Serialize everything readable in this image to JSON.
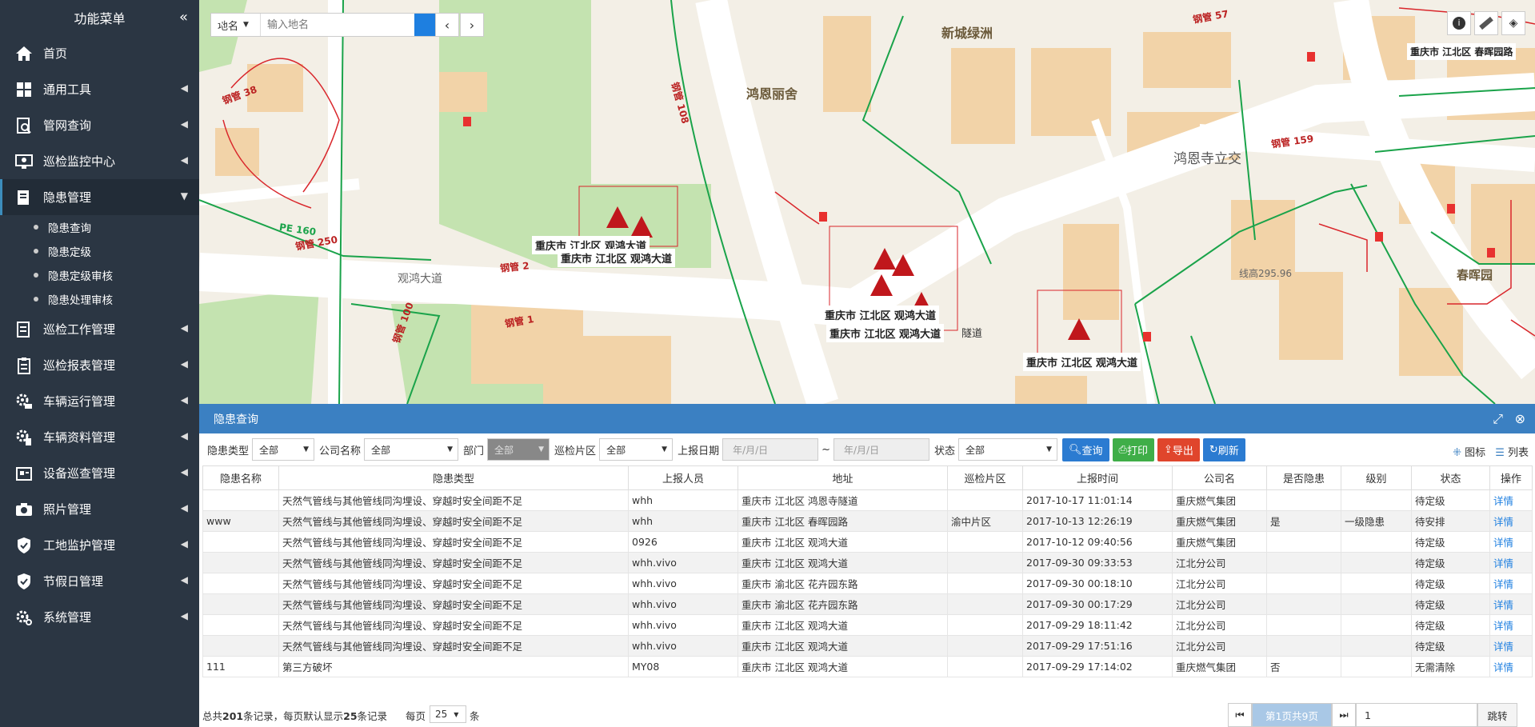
{
  "sidebar": {
    "title": "功能菜单",
    "collapse_icon": "«",
    "items": [
      {
        "label": "首页",
        "icon": "home-icon"
      },
      {
        "label": "通用工具",
        "icon": "grid-icon"
      },
      {
        "label": "管网查询",
        "icon": "search-doc-icon"
      },
      {
        "label": "巡检监控中心",
        "icon": "monitor-icon"
      },
      {
        "label": "隐患管理",
        "icon": "edit-doc-icon"
      },
      {
        "label": "巡检工作管理",
        "icon": "list-doc-icon"
      },
      {
        "label": "巡检报表管理",
        "icon": "clipboard-icon"
      },
      {
        "label": "车辆运行管理",
        "icon": "gear-car-icon"
      },
      {
        "label": "车辆资料管理",
        "icon": "gear-doc-icon"
      },
      {
        "label": "设备巡查管理",
        "icon": "device-icon"
      },
      {
        "label": "照片管理",
        "icon": "camera-icon"
      },
      {
        "label": "工地监护管理",
        "icon": "shield-icon"
      },
      {
        "label": "节假日管理",
        "icon": "shield-icon"
      },
      {
        "label": "系统管理",
        "icon": "gear-icon"
      }
    ],
    "sub_items": [
      "隐患查询",
      "隐患定级",
      "隐患定级审核",
      "隐患处理审核"
    ]
  },
  "map": {
    "search_type": "地名",
    "search_placeholder": "输入地名",
    "place_labels": [
      "新城绿洲",
      "鸿恩丽舍",
      "鸿恩寺立交",
      "春晖园",
      "观鸿大道",
      "线高295.96",
      "隧道"
    ],
    "pipe_labels": [
      "钢管 57",
      "钢管 159",
      "钢管 108",
      "钢管 38",
      "钢管 250",
      "PE 160",
      "钢管 2",
      "钢管 1",
      "钢管 100"
    ],
    "hazard_labels": [
      "重庆市 江北区 观鸿大道",
      "重庆市 江北区 观鸿大道",
      "重庆市 江北区 观鸿大道",
      "重庆市 江北区 观鸿大道",
      "重庆市 江北区 观鸿大道"
    ],
    "top_right_label": "重庆市 江北区 春晖园路"
  },
  "panel": {
    "title": "隐患查询",
    "filters": {
      "type_label": "隐患类型",
      "type_value": "全部",
      "company_label": "公司名称",
      "company_value": "全部",
      "dept_label": "部门",
      "dept_value": "全部",
      "area_label": "巡检片区",
      "area_value": "全部",
      "date_label": "上报日期",
      "date_from": "年/月/日",
      "date_sep": "~",
      "date_to": "年/月/日",
      "status_label": "状态",
      "status_value": "全部"
    },
    "buttons": {
      "query": "查询",
      "print": "打印",
      "export": "导出",
      "refresh": "刷新"
    },
    "view": {
      "icon_view": "图标",
      "list_view": "列表"
    },
    "columns": [
      "隐患名称",
      "隐患类型",
      "上报人员",
      "地址",
      "巡检片区",
      "上报时间",
      "公司名",
      "是否隐患",
      "级别",
      "状态",
      "操作"
    ],
    "rows": [
      [
        "",
        "天然气管线与其他管线同沟埋设、穿越时安全间距不足",
        "whh",
        "重庆市 江北区 鸿恩寺隧道",
        "",
        "2017-10-17 11:01:14",
        "重庆燃气集团",
        "",
        "",
        "待定级",
        "详情"
      ],
      [
        "www",
        "天然气管线与其他管线同沟埋设、穿越时安全间距不足",
        "whh",
        "重庆市 江北区 春晖园路",
        "渝中片区",
        "2017-10-13 12:26:19",
        "重庆燃气集团",
        "是",
        "一级隐患",
        "待安排",
        "详情"
      ],
      [
        "",
        "天然气管线与其他管线同沟埋设、穿越时安全间距不足",
        "0926",
        "重庆市 江北区 观鸿大道",
        "",
        "2017-10-12 09:40:56",
        "重庆燃气集团",
        "",
        "",
        "待定级",
        "详情"
      ],
      [
        "",
        "天然气管线与其他管线同沟埋设、穿越时安全间距不足",
        "whh.vivo",
        "重庆市 江北区 观鸿大道",
        "",
        "2017-09-30 09:33:53",
        "江北分公司",
        "",
        "",
        "待定级",
        "详情"
      ],
      [
        "",
        "天然气管线与其他管线同沟埋设、穿越时安全间距不足",
        "whh.vivo",
        "重庆市 渝北区 花卉园东路",
        "",
        "2017-09-30 00:18:10",
        "江北分公司",
        "",
        "",
        "待定级",
        "详情"
      ],
      [
        "",
        "天然气管线与其他管线同沟埋设、穿越时安全间距不足",
        "whh.vivo",
        "重庆市 渝北区 花卉园东路",
        "",
        "2017-09-30 00:17:29",
        "江北分公司",
        "",
        "",
        "待定级",
        "详情"
      ],
      [
        "",
        "天然气管线与其他管线同沟埋设、穿越时安全间距不足",
        "whh.vivo",
        "重庆市 江北区 观鸿大道",
        "",
        "2017-09-29 18:11:42",
        "江北分公司",
        "",
        "",
        "待定级",
        "详情"
      ],
      [
        "",
        "天然气管线与其他管线同沟埋设、穿越时安全间距不足",
        "whh.vivo",
        "重庆市 江北区 观鸿大道",
        "",
        "2017-09-29 17:51:16",
        "江北分公司",
        "",
        "",
        "待定级",
        "详情"
      ],
      [
        "111",
        "第三方破坏",
        "MY08",
        "重庆市 江北区 观鸿大道",
        "",
        "2017-09-29 17:14:02",
        "重庆燃气集团",
        "否",
        "",
        "无需清除",
        "详情"
      ]
    ],
    "pager": {
      "summary_prefix": "总共",
      "total": "201",
      "summary_mid": "条记录，每页默认显示",
      "default_size": "25",
      "summary_suffix": "条记录",
      "per_page_label": "每页",
      "page_size": "25",
      "per_page_unit": "条",
      "page_info": "第1页共9页",
      "page_input": "1",
      "jump_label": "跳转"
    }
  }
}
